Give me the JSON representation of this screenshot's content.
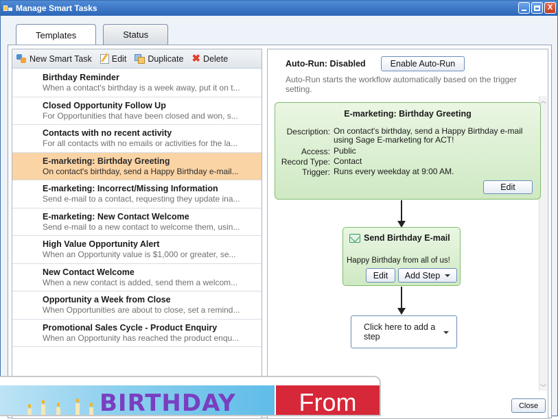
{
  "window": {
    "title": "Manage Smart Tasks",
    "controls": {
      "minimize": "–",
      "maximize": "□",
      "close": "X"
    }
  },
  "tabs": [
    {
      "label": "Templates",
      "active": true
    },
    {
      "label": "Status",
      "active": false
    }
  ],
  "toolbar": {
    "new_label": "New Smart Task",
    "edit_label": "Edit",
    "duplicate_label": "Duplicate",
    "delete_label": "Delete"
  },
  "list": [
    {
      "title": "Birthday Reminder",
      "desc": "When a contact's birthday is a week away, put it on t..."
    },
    {
      "title": "Closed Opportunity Follow Up",
      "desc": "For Opportunities that have been closed and won, s..."
    },
    {
      "title": "Contacts with no recent activity",
      "desc": "For all contacts with no emails or activities for the la..."
    },
    {
      "title": "E-marketing: Birthday Greeting",
      "desc": "On contact's birthday, send a Happy Birthday e-mail...",
      "selected": true
    },
    {
      "title": "E-marketing: Incorrect/Missing Information",
      "desc": "Send e-mail to a contact, requesting they update ina..."
    },
    {
      "title": "E-marketing: New Contact Welcome",
      "desc": "Send e-mail to a new contact to welcome them, usin..."
    },
    {
      "title": "High Value Opportunity Alert",
      "desc": "When an Opportunity value is $1,000 or greater, se..."
    },
    {
      "title": "New Contact Welcome",
      "desc": "When a new contact is added, send them a welcom..."
    },
    {
      "title": "Opportunity a Week from Close",
      "desc": "When Opportunities are about to close, set a remind..."
    },
    {
      "title": "Promotional Sales Cycle - Product Enquiry",
      "desc": "When an Opportunity has reached the product enqu..."
    }
  ],
  "autorun": {
    "status_label": "Auto-Run: Disabled",
    "enable_button": "Enable Auto-Run",
    "description": "Auto-Run starts the workflow automatically based on the trigger setting."
  },
  "trigger": {
    "title": "E-marketing: Birthday Greeting",
    "description_label": "Description:",
    "description": "On contact's birthday, send a Happy Birthday e-mail using Sage E-marketing for ACT!",
    "access_label": "Access:",
    "access": "Public",
    "record_type_label": "Record Type:",
    "record_type": "Contact",
    "trigger_label": "Trigger:",
    "trigger": "Runs every weekday at 9:00 AM.",
    "edit_button": "Edit"
  },
  "step": {
    "title": "Send Birthday E-mail",
    "text": "Happy Birthday from all of us!",
    "edit_button": "Edit",
    "add_step_button": "Add Step"
  },
  "add_step": {
    "label": "Click here to add a step"
  },
  "footer": {
    "close_button": "Close"
  },
  "promo": {
    "banner_word": "BIRTHDAY",
    "red_text": "From"
  },
  "colors": {
    "title_bar": "#2c66b8",
    "selected_row": "#fbd4a5",
    "step_green": "#cfe9c3",
    "promo_red": "#d62839"
  }
}
